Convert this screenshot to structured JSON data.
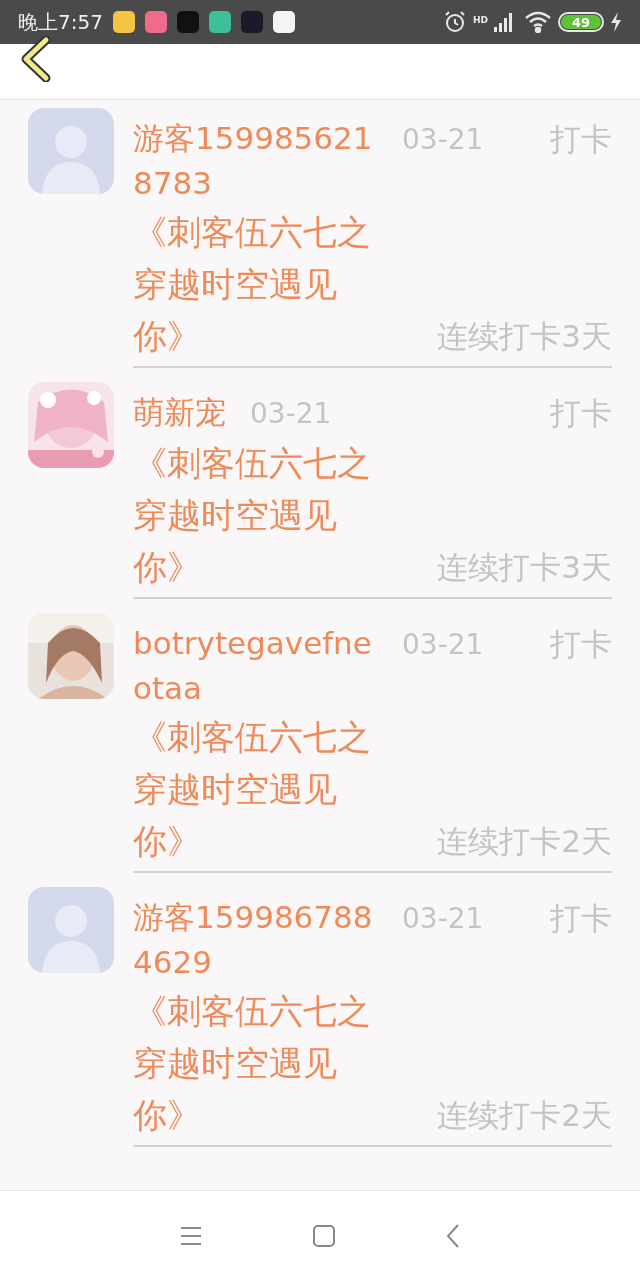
{
  "status_bar": {
    "time": "晚上7:57",
    "app_icons": [
      {
        "color": "#f5c342"
      },
      {
        "color": "#f06a8a"
      },
      {
        "color": "#111111"
      },
      {
        "color": "#3dbf9c"
      },
      {
        "color": "#1a1a2a"
      },
      {
        "color": "#f4f4f4"
      }
    ],
    "network": "HD",
    "battery": "49"
  },
  "entries": [
    {
      "kind": "default",
      "name": "游客1599856218783",
      "date": "03-21",
      "action": "打卡",
      "title": "《刺客伍六七之穿越时空遇见你》",
      "streak": "连续打卡3天"
    },
    {
      "kind": "picture",
      "name": "萌新宠",
      "date": "03-21",
      "action": "打卡",
      "title": "《刺客伍六七之穿越时空遇见你》",
      "streak": "连续打卡3天"
    },
    {
      "name": "botrytegavefneotaa",
      "date": "03-21",
      "action": "打卡",
      "title": "《刺客伍六七之穿越时空遇见你》",
      "streak": "连续打卡2天"
    },
    {
      "kind": "default",
      "name": "游客1599867884629",
      "date": "03-21",
      "action": "打卡",
      "title": "《刺客伍六七之穿越时空遇见你》",
      "streak": "连续打卡2天"
    }
  ]
}
